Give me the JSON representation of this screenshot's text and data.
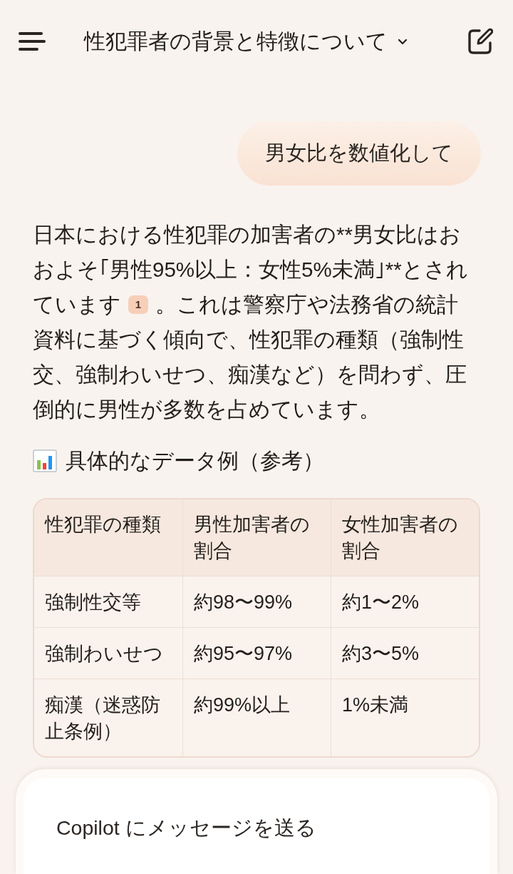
{
  "header": {
    "title": "性犯罪者の背景と特徴について"
  },
  "user_message": {
    "text": "男女比を数値化して"
  },
  "answer": {
    "parts": [
      {
        "kind": "text",
        "text": "日本における性犯罪の加害者の**男女比はおおよそ｢男性95%以上：女性5%未満｣**とされています"
      },
      {
        "kind": "citation",
        "text": "1"
      },
      {
        "kind": "text",
        "text": "。これは警察庁や法務省の統計資料に基づく傾向で、性犯罪の種類（強制性交、強制わいせつ、痴漢など）を問わず、圧倒的に男性が多数を占めています。"
      }
    ]
  },
  "data_heading": {
    "text": "具体的なデータ例（参考）"
  },
  "table": {
    "columns": [
      "性犯罪の種類",
      "男性加害者の割合",
      "女性加害者の割合"
    ],
    "rows": [
      [
        "強制性交等",
        "約98〜99%",
        "約1〜2%"
      ],
      [
        "強制わいせつ",
        "約95〜97%",
        "約3〜5%"
      ],
      [
        "痴漢（迷惑防止条例）",
        "約99%以上",
        "1%未満"
      ]
    ]
  },
  "composer": {
    "placeholder": "Copilot にメッセージを送る"
  }
}
